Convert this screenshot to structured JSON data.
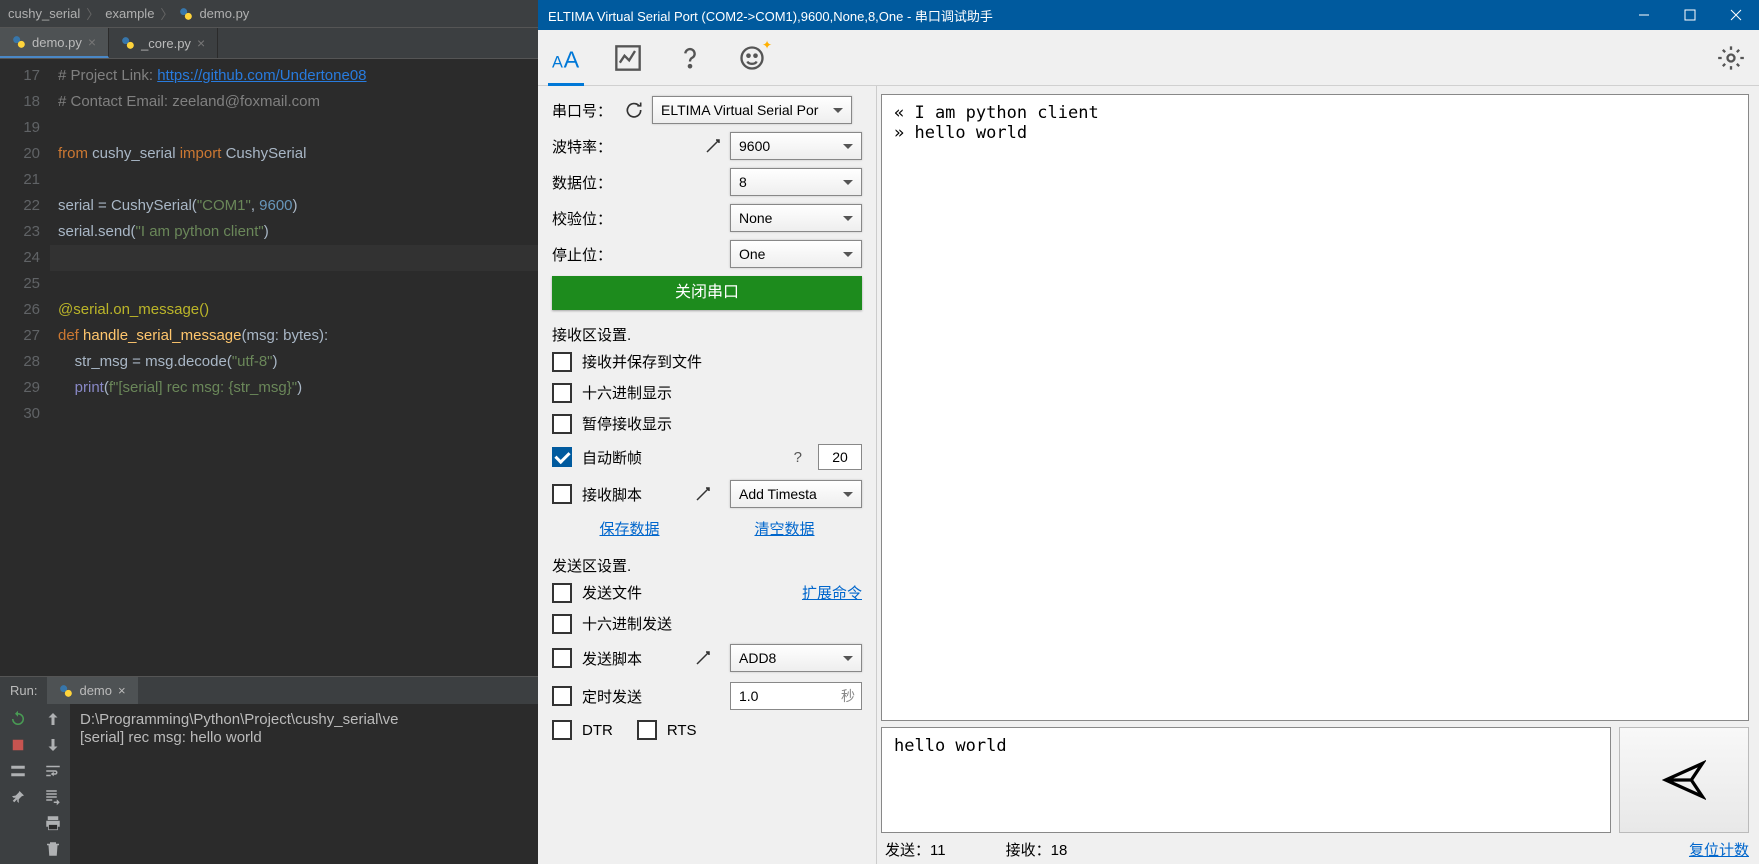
{
  "ide": {
    "breadcrumb": [
      "cushy_serial",
      "example",
      "demo.py"
    ],
    "tabs": [
      {
        "name": "demo.py",
        "active": true
      },
      {
        "name": "_core.py",
        "active": false
      }
    ],
    "gutter_start": 17,
    "code_lines": [
      {
        "t": "comment",
        "text": "# Project Link: ",
        "link": "https://github.com/Undertone08"
      },
      {
        "t": "comment",
        "text": "# Contact Email: zeeland@foxmail.com"
      },
      {
        "t": "blank"
      },
      {
        "t": "import",
        "kw1": "from",
        "mod": "cushy_serial",
        "kw2": "import",
        "cls": "CushySerial"
      },
      {
        "t": "blank"
      },
      {
        "t": "assign",
        "var": "serial",
        "cls": "CushySerial",
        "args": "\"COM1\", 9600",
        "s": "\"COM1\"",
        "n": "9600"
      },
      {
        "t": "call",
        "obj": "serial",
        "fn": "send",
        "arg": "\"I am python client\""
      },
      {
        "t": "blank_hl"
      },
      {
        "t": "blank"
      },
      {
        "t": "decorator",
        "text": "@serial.on_message()"
      },
      {
        "t": "def",
        "kw": "def",
        "fn": "handle_serial_message",
        "params": "(msg: bytes):"
      },
      {
        "t": "body1",
        "var": "str_msg",
        "call": "msg.decode",
        "arg": "\"utf-8\""
      },
      {
        "t": "body2",
        "fn": "print",
        "farg": "f\"[serial] rec msg: {str_msg}\""
      },
      {
        "t": "blank"
      }
    ],
    "run": {
      "label": "Run:",
      "tab": "demo",
      "out1": "D:\\Programming\\Python\\Project\\cushy_serial\\ve",
      "out2": "[serial] rec msg: hello world"
    }
  },
  "serial": {
    "title": "ELTIMA Virtual Serial Port (COM2->COM1),9600,None,8,One - 串口调试助手",
    "port": {
      "label": "串口号：",
      "value": "ELTIMA Virtual Serial Por"
    },
    "baud": {
      "label": "波特率：",
      "value": "9600"
    },
    "databits": {
      "label": "数据位：",
      "value": "8"
    },
    "parity": {
      "label": "校验位：",
      "value": "None"
    },
    "stopbits": {
      "label": "停止位：",
      "value": "One"
    },
    "close_btn": "关闭串口",
    "recv_section": "接收区设置.",
    "recv_save": "接收并保存到文件",
    "recv_hex": "十六进制显示",
    "recv_pause": "暂停接收显示",
    "recv_autoframe": "自动断帧",
    "recv_autoframe_val": "20",
    "recv_script": "接收脚本",
    "recv_script_val": "Add Timesta",
    "save_data": "保存数据",
    "clear_data": "清空数据",
    "send_section": "发送区设置.",
    "send_file": "发送文件",
    "ext_cmd": "扩展命令",
    "send_hex": "十六进制发送",
    "send_script": "发送脚本",
    "send_script_val": "ADD8",
    "timed_send": "定时发送",
    "timed_send_val": "1.0",
    "timed_unit": "秒",
    "dtr": "DTR",
    "rts": "RTS",
    "recv_text": "« I am python client\n» hello world",
    "send_text": "hello world",
    "stat_send_label": "发送：",
    "stat_send": "11",
    "stat_recv_label": "接收：",
    "stat_recv": "18",
    "reset": "复位计数"
  }
}
